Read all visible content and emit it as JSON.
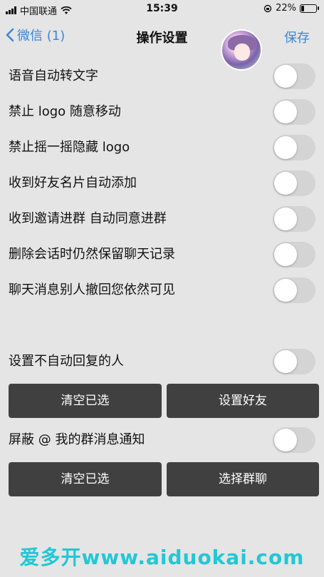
{
  "status": {
    "carrier": "中国联通",
    "time": "15:39",
    "battery": "22%",
    "battery_level": 0.22
  },
  "nav": {
    "back_label": "微信 (1)",
    "title": "操作设置",
    "save_label": "保存"
  },
  "settings": [
    {
      "label": "语音自动转文字",
      "on": false
    },
    {
      "label": "禁止 logo 随意移动",
      "on": false
    },
    {
      "label": "禁止摇一摇隐藏 logo",
      "on": false
    },
    {
      "label": "收到好友名片自动添加",
      "on": false
    },
    {
      "label": "收到邀请进群 自动同意进群",
      "on": false
    },
    {
      "label": "删除会话时仍然保留聊天记录",
      "on": false
    },
    {
      "label": "聊天消息别人撤回您依然可见",
      "on": false
    }
  ],
  "auto_reply": {
    "label": "设置不自动回复的人",
    "on": false,
    "clear_label": "清空已选",
    "set_label": "设置好友"
  },
  "mute_at": {
    "label": "屏蔽 @ 我的群消息通知",
    "on": false,
    "clear_label": "清空已选",
    "select_label": "选择群聊"
  },
  "watermark": "爱多开www.aiduokai.com"
}
